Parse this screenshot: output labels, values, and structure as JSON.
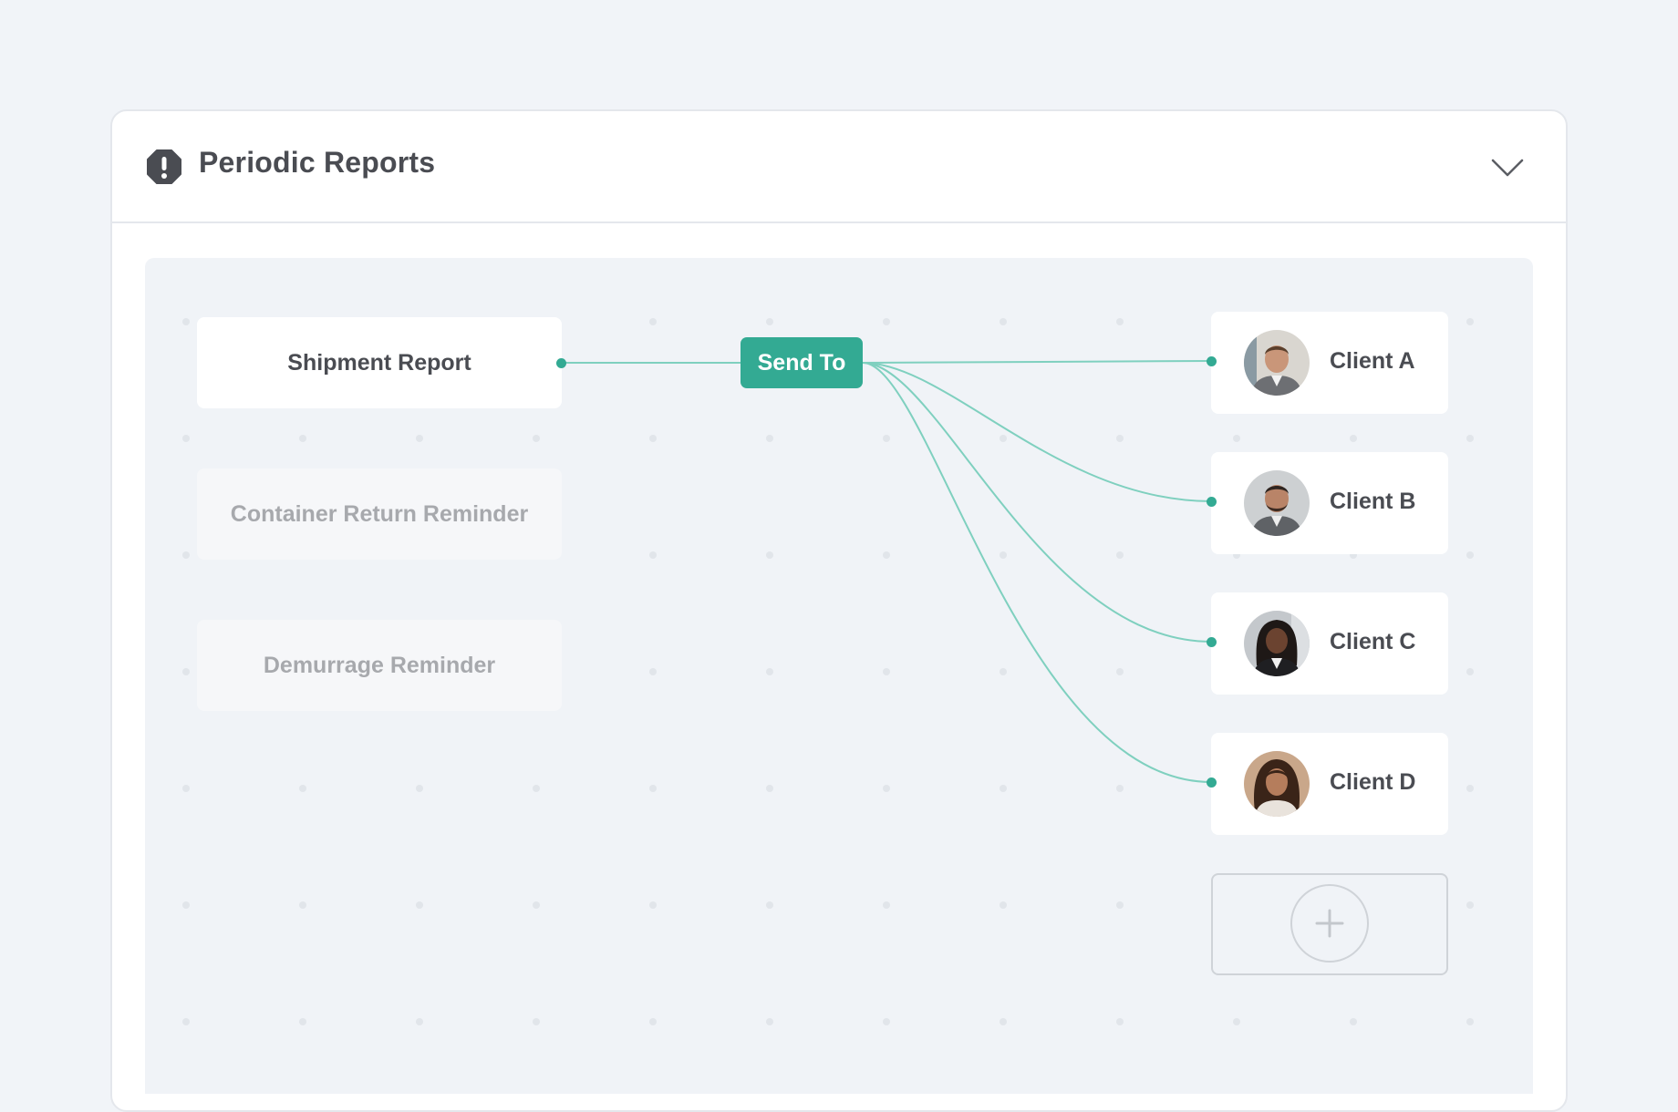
{
  "header": {
    "title": "Periodic Reports",
    "alert_icon": "alert-octagon-icon",
    "collapse_icon": "chevron-down-icon"
  },
  "flow": {
    "reports": [
      {
        "label": "Shipment Report",
        "active": true
      },
      {
        "label": "Container Return Reminder",
        "active": false
      },
      {
        "label": "Demurrage Reminder",
        "active": false
      }
    ],
    "action_label": "Send To",
    "clients": [
      {
        "name": "Client A"
      },
      {
        "name": "Client B"
      },
      {
        "name": "Client C"
      },
      {
        "name": "Client D"
      }
    ],
    "add_icon": "plus-icon"
  },
  "colors": {
    "accent": "#33aa93",
    "link": "#7fd0bf",
    "text": "#4a4c52",
    "muted": "#a7a9ad"
  }
}
